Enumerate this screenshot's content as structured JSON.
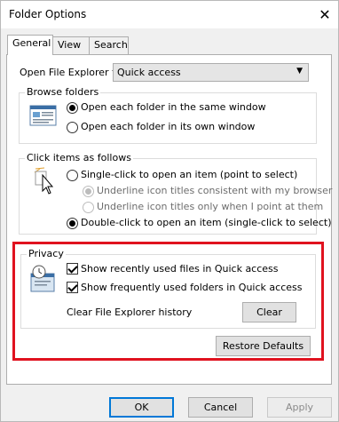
{
  "window": {
    "title": "Folder Options",
    "close_glyph": "✕"
  },
  "tabs": [
    {
      "label": "General",
      "active": true
    },
    {
      "label": "View",
      "active": false
    },
    {
      "label": "Search",
      "active": false
    }
  ],
  "open_explorer": {
    "label": "Open File Explorer to:",
    "value": "Quick access"
  },
  "browse_folders": {
    "title": "Browse folders",
    "options": [
      {
        "label": "Open each folder in the same window",
        "selected": true
      },
      {
        "label": "Open each folder in its own window",
        "selected": false
      }
    ]
  },
  "click_items": {
    "title": "Click items as follows",
    "options": [
      {
        "label": "Single-click to open an item (point to select)",
        "selected": false
      },
      {
        "label": "Underline icon titles consistent with my browser",
        "selected": true,
        "disabled": true
      },
      {
        "label": "Underline icon titles only when I point at them",
        "selected": false,
        "disabled": true
      },
      {
        "label": "Double-click to open an item (single-click to select)",
        "selected": true
      }
    ]
  },
  "privacy": {
    "title": "Privacy",
    "show_recent_files": {
      "label": "Show recently used files in Quick access",
      "checked": true
    },
    "show_frequent_folders": {
      "label": "Show frequently used folders in Quick access",
      "checked": true
    },
    "clear_history_label": "Clear File Explorer history",
    "clear_button": "Clear"
  },
  "restore_defaults": "Restore Defaults",
  "footer": {
    "ok": "OK",
    "cancel": "Cancel",
    "apply": "Apply"
  },
  "colors": {
    "highlight": "#e0121f",
    "accent": "#0078d7"
  }
}
